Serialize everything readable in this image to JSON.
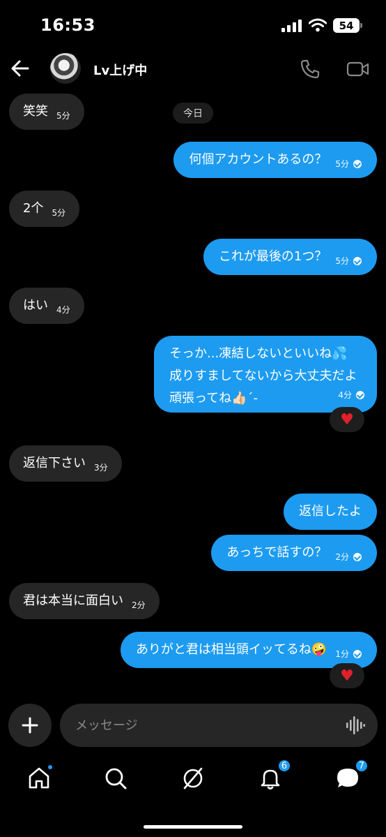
{
  "status_bar": {
    "time": "16:53",
    "battery": "54"
  },
  "header": {
    "contact_name": "Lv上げ中"
  },
  "date_chip": "今日",
  "messages": [
    {
      "text": "笑笑",
      "time": "5分"
    },
    {
      "text": "何個アカウントあるの？",
      "time": "5分"
    },
    {
      "text": "2个",
      "time": "5分"
    },
    {
      "text": "これが最後の1つ？",
      "time": "5分"
    },
    {
      "text": "はい",
      "time": "4分"
    },
    {
      "lines": [
        "そっか...凍結しないといいね💦",
        "成りすましてないから大丈夫だよ",
        "頑張ってね👍🏻´-"
      ],
      "time": "4分",
      "reaction": "♥"
    },
    {
      "text": "返信下さい",
      "time": "3分"
    },
    {
      "text": "返信したよ"
    },
    {
      "text": "あっちで話すの？",
      "time": "2分"
    },
    {
      "text": "君は本当に面白い",
      "time": "2分"
    },
    {
      "text": "ありがと君は相当頭イッてるね🤪",
      "time": "1分",
      "reaction": "♥"
    }
  ],
  "composer": {
    "placeholder": "メッセージ"
  },
  "tabbar": {
    "notifications_badge": "6",
    "messages_badge": "7"
  },
  "colors": {
    "accent": "#1d9bf0",
    "incoming_bubble": "#262626",
    "background": "#000000",
    "heart": "#e0202c"
  }
}
